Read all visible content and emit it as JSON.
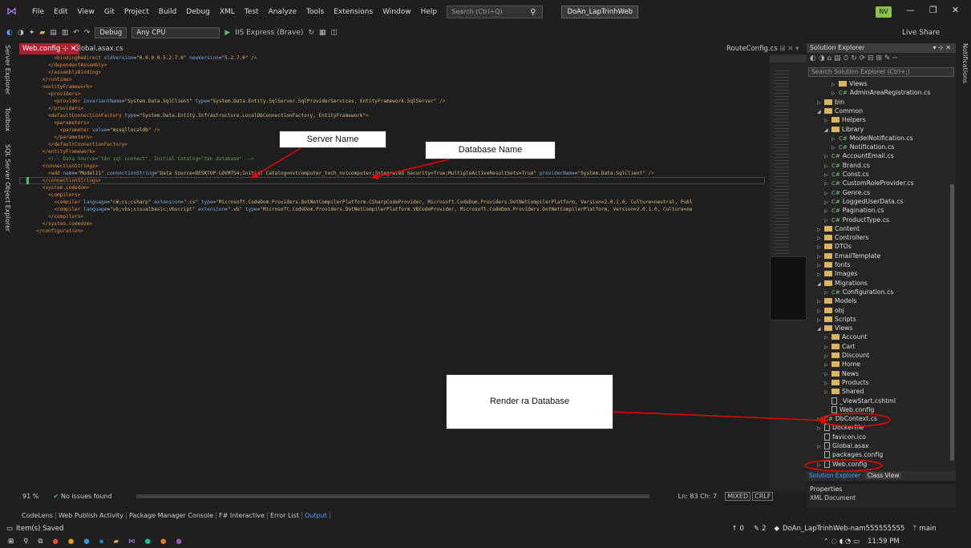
{
  "app": {
    "menu": [
      "File",
      "Edit",
      "View",
      "Git",
      "Project",
      "Build",
      "Debug",
      "XML",
      "Test",
      "Analyze",
      "Tools",
      "Extensions",
      "Window",
      "Help"
    ],
    "search_placeholder": "Search (Ctrl+Q)",
    "project_name": "DoAn_LapTrinhWeb",
    "avatar": "NV",
    "live_share": "Live Share"
  },
  "toolbar": {
    "config": "Debug",
    "platform": "Any CPU",
    "run_target": "IIS Express (Brave)"
  },
  "left_tabs": [
    "Server Explorer",
    "Toolbox",
    "SQL Server Object Explorer"
  ],
  "right_tab": "Notifications",
  "editor_tabs": {
    "active": "Web.config",
    "second": "Global.asax.cs",
    "right": "RouteConfig.cs"
  },
  "code_lines": [
    [
      [
        "tg",
        "        <bindingRedirect "
      ],
      [
        "at",
        "oldVersion"
      ],
      [
        "tx",
        "="
      ],
      [
        "av",
        "\"0.0.0.0-5.2.7.0\""
      ],
      [
        "tx",
        " "
      ],
      [
        "at",
        "newVersion"
      ],
      [
        "tx",
        "="
      ],
      [
        "av",
        "\"5.2.7.0\""
      ],
      [
        "tg",
        " />"
      ]
    ],
    [
      [
        "tg",
        "      </dependentAssembly>"
      ]
    ],
    [
      [
        "tg",
        "      </assemblyBinding>"
      ]
    ],
    [
      [
        "tg",
        "    </runtime>"
      ]
    ],
    [
      [
        "tg",
        "    <entityFramework>"
      ]
    ],
    [
      [
        "tg",
        "      <providers>"
      ]
    ],
    [
      [
        "tg",
        "        <provider "
      ],
      [
        "at",
        "invariantName"
      ],
      [
        "tx",
        "="
      ],
      [
        "av",
        "\"System.Data.SqlClient\""
      ],
      [
        "tx",
        " "
      ],
      [
        "at",
        "type"
      ],
      [
        "tx",
        "="
      ],
      [
        "av",
        "\"System.Data.Entity.SqlServer.SqlProviderServices, EntityFramework.SqlServer\""
      ],
      [
        "tg",
        " />"
      ]
    ],
    [
      [
        "tg",
        "      </providers>"
      ]
    ],
    [
      [
        "tg",
        "      <defaultConnectionFactory "
      ],
      [
        "at",
        "type"
      ],
      [
        "tx",
        "="
      ],
      [
        "av",
        "\"System.Data.Entity.Infrastructure.LocalDbConnectionFactory, EntityFramework\""
      ],
      [
        "tg",
        ">"
      ]
    ],
    [
      [
        "tg",
        "        <parameters>"
      ]
    ],
    [
      [
        "tg",
        "          <parameter "
      ],
      [
        "at",
        "value"
      ],
      [
        "tx",
        "="
      ],
      [
        "av",
        "\"mssqllocaldb\""
      ],
      [
        "tg",
        " />"
      ]
    ],
    [
      [
        "tg",
        "        </parameters>"
      ]
    ],
    [
      [
        "tg",
        "      </defaultConnectionFactory>"
      ]
    ],
    [
      [
        "tg",
        "    </entityFramework>"
      ]
    ],
    [
      [
        "cm",
        "      <!-- Data Source=\"tên sql connect\", Initial Catalog=\"tên database\" -->"
      ]
    ],
    [
      [
        "tg",
        "    <connectionStrings>"
      ]
    ],
    [
      [
        "tg",
        "      <add "
      ],
      [
        "at",
        "name"
      ],
      [
        "tx",
        "="
      ],
      [
        "av",
        "\"Model11\""
      ],
      [
        "tx",
        " "
      ],
      [
        "at",
        "connectionString"
      ],
      [
        "tx",
        "="
      ],
      [
        "av",
        "\"Data Source=DESKTOP-LDVM7S4;Initial Catalog=nvtcomputer_tech_nvtcomputer;Integrated Security=True;MultipleActiveResultSets=True\""
      ],
      [
        "tx",
        " "
      ],
      [
        "at",
        "providerName"
      ],
      [
        "tx",
        "="
      ],
      [
        "av",
        "\"System.Data.SqlClient\""
      ],
      [
        "tg",
        " />"
      ]
    ],
    [
      [
        "tg",
        "    </connectionStrings>"
      ]
    ],
    [
      [
        "tg",
        "    <system.codedom>"
      ]
    ],
    [
      [
        "tg",
        "      <compilers>"
      ]
    ],
    [
      [
        "tg",
        "        <compiler "
      ],
      [
        "at",
        "language"
      ],
      [
        "tx",
        "="
      ],
      [
        "av",
        "\"c#;cs;csharp\""
      ],
      [
        "tx",
        " "
      ],
      [
        "at",
        "extension"
      ],
      [
        "tx",
        "="
      ],
      [
        "av",
        "\".cs\""
      ],
      [
        "tx",
        " "
      ],
      [
        "at",
        "type"
      ],
      [
        "tx",
        "="
      ],
      [
        "av",
        "\"Microsoft.CodeDom.Providers.DotNetCompilerPlatform.CSharpCodeProvider, Microsoft.CodeDom.Providers.DotNetCompilerPlatform, Version=2.0.1.0, Culture=neutral, Publ"
      ]
    ],
    [
      [
        "tg",
        "        <compiler "
      ],
      [
        "at",
        "language"
      ],
      [
        "tx",
        "="
      ],
      [
        "av",
        "\"vb;vbs;visualbasic;vbscript\""
      ],
      [
        "tx",
        " "
      ],
      [
        "at",
        "extension"
      ],
      [
        "tx",
        "="
      ],
      [
        "av",
        "\".vb\""
      ],
      [
        "tx",
        " "
      ],
      [
        "at",
        "type"
      ],
      [
        "tx",
        "="
      ],
      [
        "av",
        "\"Microsoft.CodeDom.Providers.DotNetCompilerPlatform.VBCodeProvider, Microsoft.CodeDom.Providers.DotNetCompilerPlatform, Version=2.0.1.0, Culture=ne"
      ]
    ],
    [
      [
        "tg",
        "      </compilers>"
      ]
    ],
    [
      [
        "tg",
        "    </system.codedom>"
      ]
    ],
    [
      [
        "tg",
        "  </configuration>"
      ]
    ]
  ],
  "callouts": {
    "server": "Server  Name",
    "database": "Database Name",
    "render": "Render ra Database"
  },
  "editor_status": {
    "zoom": "91 %",
    "issues": "No issues found",
    "position": "Ln: 83   Ch: 7",
    "encoding": "MIXED",
    "eol": "CRLF"
  },
  "bottom_tabs": [
    "CodeLens",
    "Web Publish Activity",
    "Package Manager Console",
    "F# Interactive",
    "Error List",
    "Output"
  ],
  "status_bar": {
    "left": "Item(s) Saved",
    "up": "0",
    "changes": "2",
    "repo": "DoAn_LapTrinhWeb-nam555555555",
    "branch": "main"
  },
  "taskbar": {
    "time": "11:59 PM"
  },
  "solution_explorer": {
    "title": "Solution Explorer",
    "search_placeholder": "Search Solution Explorer (Ctrl+;)",
    "items": [
      {
        "label": "Views",
        "indent": 3,
        "kind": "folder",
        "arrow": "▷"
      },
      {
        "label": "AdminAreaRegistration.cs",
        "indent": 3,
        "kind": "cs",
        "arrow": "▷"
      },
      {
        "label": "bin",
        "indent": 1,
        "kind": "folder",
        "arrow": "▷"
      },
      {
        "label": "Common",
        "indent": 1,
        "kind": "folder",
        "arrow": "◢"
      },
      {
        "label": "Helpers",
        "indent": 2,
        "kind": "folder",
        "arrow": "▷"
      },
      {
        "label": "Library",
        "indent": 2,
        "kind": "folder",
        "arrow": "◢"
      },
      {
        "label": "ModelNotification.cs",
        "indent": 3,
        "kind": "cs",
        "arrow": "▷"
      },
      {
        "label": "Notification.cs",
        "indent": 3,
        "kind": "cs",
        "arrow": "▷"
      },
      {
        "label": "AccountEmail.cs",
        "indent": 2,
        "kind": "cs",
        "arrow": "▷"
      },
      {
        "label": "Brand.cs",
        "indent": 2,
        "kind": "cs",
        "arrow": "▷"
      },
      {
        "label": "Const.cs",
        "indent": 2,
        "kind": "cs",
        "arrow": "▷"
      },
      {
        "label": "CustomRoleProvider.cs",
        "indent": 2,
        "kind": "cs",
        "arrow": "▷"
      },
      {
        "label": "Genre.cs",
        "indent": 2,
        "kind": "cs",
        "arrow": "▷"
      },
      {
        "label": "LoggedUserData.cs",
        "indent": 2,
        "kind": "cs",
        "arrow": "▷"
      },
      {
        "label": "Pagination.cs",
        "indent": 2,
        "kind": "cs",
        "arrow": "▷"
      },
      {
        "label": "ProductType.cs",
        "indent": 2,
        "kind": "cs",
        "arrow": "▷"
      },
      {
        "label": "Content",
        "indent": 1,
        "kind": "folder",
        "arrow": "▷"
      },
      {
        "label": "Controllers",
        "indent": 1,
        "kind": "folder",
        "arrow": "▷"
      },
      {
        "label": "DTOs",
        "indent": 1,
        "kind": "folder",
        "arrow": "▷"
      },
      {
        "label": "EmailTemplate",
        "indent": 1,
        "kind": "folder",
        "arrow": "▷"
      },
      {
        "label": "fonts",
        "indent": 1,
        "kind": "folder",
        "arrow": "▷"
      },
      {
        "label": "Images",
        "indent": 1,
        "kind": "folder",
        "arrow": "▷"
      },
      {
        "label": "Migrations",
        "indent": 1,
        "kind": "folder",
        "arrow": "◢"
      },
      {
        "label": "Configuration.cs",
        "indent": 2,
        "kind": "cs",
        "arrow": "▷"
      },
      {
        "label": "Models",
        "indent": 1,
        "kind": "folder",
        "arrow": "▷"
      },
      {
        "label": "obj",
        "indent": 1,
        "kind": "folder",
        "arrow": "▷"
      },
      {
        "label": "Scripts",
        "indent": 1,
        "kind": "folder",
        "arrow": "▷"
      },
      {
        "label": "Views",
        "indent": 1,
        "kind": "folder",
        "arrow": "◢"
      },
      {
        "label": "Account",
        "indent": 2,
        "kind": "folder",
        "arrow": "▷"
      },
      {
        "label": "Cart",
        "indent": 2,
        "kind": "folder",
        "arrow": "▷"
      },
      {
        "label": "Discount",
        "indent": 2,
        "kind": "folder",
        "arrow": "▷"
      },
      {
        "label": "Home",
        "indent": 2,
        "kind": "folder",
        "arrow": "▷"
      },
      {
        "label": "News",
        "indent": 2,
        "kind": "folder",
        "arrow": "▷"
      },
      {
        "label": "Products",
        "indent": 2,
        "kind": "folder",
        "arrow": "▷"
      },
      {
        "label": "Shared",
        "indent": 2,
        "kind": "folder",
        "arrow": "▷"
      },
      {
        "label": "_ViewStart.cshtml",
        "indent": 2,
        "kind": "file",
        "arrow": ""
      },
      {
        "label": "Web.config",
        "indent": 2,
        "kind": "file",
        "arrow": ""
      },
      {
        "label": "DbContext.cs",
        "indent": 1,
        "kind": "cs",
        "arrow": "▷"
      },
      {
        "label": "Dockerfile",
        "indent": 1,
        "kind": "file",
        "arrow": "▷"
      },
      {
        "label": "favicon.ico",
        "indent": 1,
        "kind": "file",
        "arrow": ""
      },
      {
        "label": "Global.asax",
        "indent": 1,
        "kind": "file",
        "arrow": "▷"
      },
      {
        "label": "packages.config",
        "indent": 1,
        "kind": "file",
        "arrow": ""
      },
      {
        "label": "Web.config",
        "indent": 1,
        "kind": "file",
        "arrow": "▷"
      }
    ],
    "footer_tabs": [
      "Solution Explorer",
      "Class View"
    ],
    "properties_title": "Properties",
    "properties_sub": "XML Document"
  }
}
